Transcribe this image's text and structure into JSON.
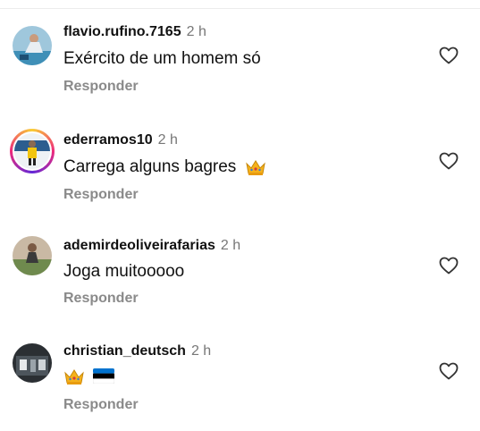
{
  "comments": [
    {
      "username": "flavio.rufino.7165",
      "time": "2 h",
      "text": "Exército de um homem só",
      "reply_label": "Responder"
    },
    {
      "username": "ederramos10",
      "time": "2 h",
      "text": "Carrega alguns bagres",
      "reply_label": "Responder"
    },
    {
      "username": "ademirdeoliveirafarias",
      "time": "2 h",
      "text": "Joga muitooooo",
      "reply_label": "Responder"
    },
    {
      "username": "christian_deutsch",
      "time": "2 h",
      "text": "",
      "reply_label": "Responder"
    }
  ],
  "icons": {
    "like": "heart-outline-icon",
    "crown": "crown-emoji",
    "flag": "estonia-flag-emoji"
  },
  "colors": {
    "text": "#111111",
    "muted": "#8a8a8a",
    "story_ring": "#ee2a7b"
  }
}
